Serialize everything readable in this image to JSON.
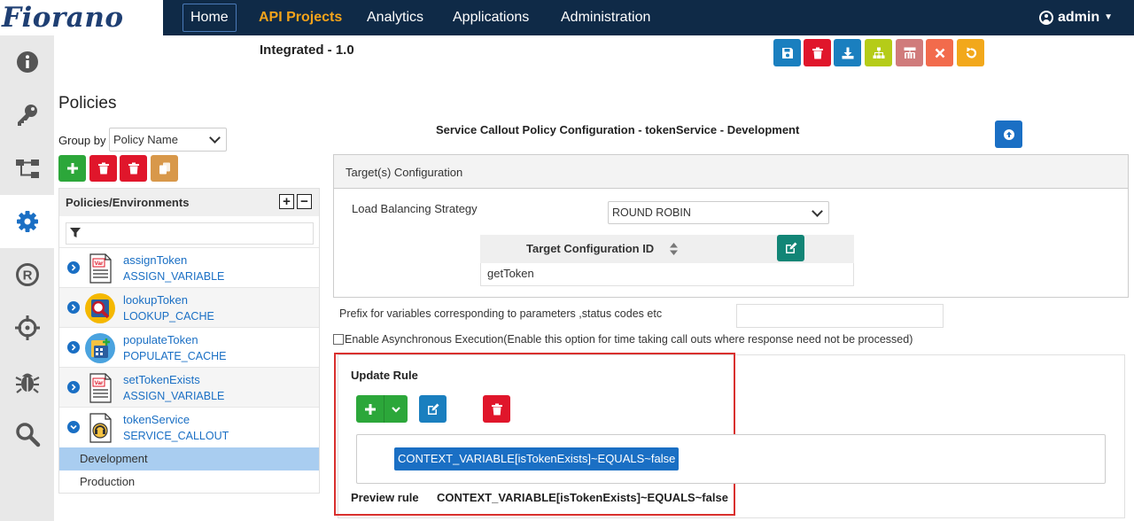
{
  "brand": {
    "logo_text": "Fiorano"
  },
  "nav": {
    "home": "Home",
    "api_projects": "API Projects",
    "analytics": "Analytics",
    "applications": "Applications",
    "administration": "Administration",
    "user": "admin"
  },
  "sidebar": {
    "icons": [
      "info-icon",
      "key-icon",
      "flow-icon",
      "gear-icon",
      "registered-icon",
      "target-icon",
      "bug-icon",
      "search-icon"
    ],
    "active": "gear-icon"
  },
  "project": {
    "title": "Integrated - 1.0"
  },
  "toolbar": {
    "buttons": [
      {
        "name": "save",
        "color": "#1a7fbf",
        "icon": "floppy-icon"
      },
      {
        "name": "delete",
        "color": "#e0162b",
        "icon": "trash-icon"
      },
      {
        "name": "download",
        "color": "#1a7fbf",
        "icon": "download-icon"
      },
      {
        "name": "hierarchy",
        "color": "#b5cc18",
        "icon": "sitemap-icon"
      },
      {
        "name": "hierarchy-alt",
        "color": "#d07b7b",
        "icon": "sitemap-alt-icon"
      },
      {
        "name": "close",
        "color": "#f26b4c",
        "icon": "close-icon"
      },
      {
        "name": "undo",
        "color": "#f2a81b",
        "icon": "undo-icon"
      }
    ]
  },
  "policies": {
    "heading": "Policies",
    "group_by_label": "Group by",
    "group_by_value": "Policy Name",
    "tree_header": "Policies/Environments",
    "filter_value": "",
    "items": [
      {
        "name": "assignToken",
        "type": "ASSIGN_VARIABLE",
        "glyph": "document-var-icon",
        "expanded": false
      },
      {
        "name": "lookupToken",
        "type": "LOOKUP_CACHE",
        "glyph": "lookup-cache-icon",
        "expanded": false
      },
      {
        "name": "populateToken",
        "type": "POPULATE_CACHE",
        "glyph": "populate-cache-icon",
        "expanded": false
      },
      {
        "name": "setTokenExists",
        "type": "ASSIGN_VARIABLE",
        "glyph": "document-var-icon",
        "expanded": false
      },
      {
        "name": "tokenService",
        "type": "SERVICE_CALLOUT",
        "glyph": "service-callout-icon",
        "expanded": true
      }
    ],
    "environments": [
      {
        "label": "Development",
        "selected": true
      },
      {
        "label": "Production",
        "selected": false
      }
    ]
  },
  "config": {
    "title": "Service Callout Policy Configuration - tokenService - Development",
    "targets_header": "Target(s) Configuration",
    "lb_label": "Load Balancing Strategy",
    "lb_value": "ROUND ROBIN",
    "target_table_header": "Target Configuration ID",
    "target_rows": [
      "getToken"
    ],
    "prefix_label": "Prefix for variables corresponding to parameters ,status codes etc",
    "prefix_value": "",
    "async_label": "Enable Asynchronous Execution(Enable this option for time taking call outs where response need not be processed)",
    "async_checked": false
  },
  "update_rule": {
    "title": "Update Rule",
    "rule_chip": "CONTEXT_VARIABLE[isTokenExists]~EQUALS~false",
    "preview_label": "Preview rule",
    "preview_value": "CONTEXT_VARIABLE[isTokenExists]~EQUALS~false"
  },
  "colors": {
    "navbar": "#0f2a47",
    "api_projects_accent": "#f3a31b",
    "link_blue": "#1a6fc4",
    "add_green": "#2ca73a",
    "delete_red": "#e0162b",
    "copy_orange": "#d8984a",
    "edit_teal": "#128576",
    "highlight_red": "#d9302e",
    "selected_env": "#a9cdf0"
  }
}
